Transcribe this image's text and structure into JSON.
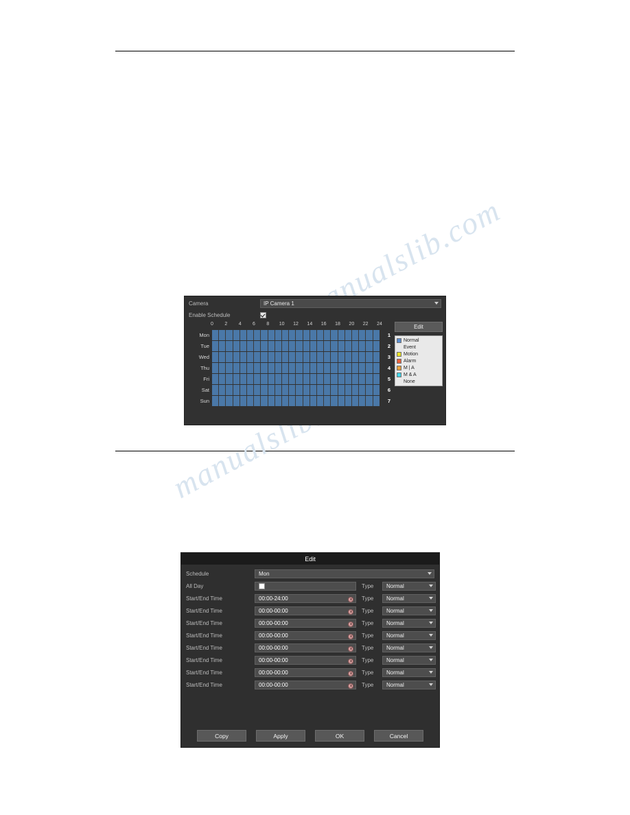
{
  "page": {
    "rules": [
      "top-rule",
      "bottom-rule"
    ],
    "watermark_text": "manualslib.com",
    "watermark_color": "#d8e4ef"
  },
  "figure_schedule": {
    "camera": {
      "label": "Camera",
      "value": "IP Camera 1"
    },
    "enable_schedule": {
      "label": "Enable Schedule",
      "checked": true
    },
    "hour_ticks": [
      "0",
      "2",
      "4",
      "6",
      "8",
      "10",
      "12",
      "14",
      "16",
      "18",
      "20",
      "22",
      "24"
    ],
    "days": [
      {
        "name": "Mon",
        "number": "1"
      },
      {
        "name": "Tue",
        "number": "2"
      },
      {
        "name": "Wed",
        "number": "3"
      },
      {
        "name": "Thu",
        "number": "4"
      },
      {
        "name": "Fri",
        "number": "5"
      },
      {
        "name": "Sat",
        "number": "6"
      },
      {
        "name": "Sun",
        "number": "7"
      }
    ],
    "edit_button": "Edit",
    "legend": [
      {
        "label": "Normal",
        "color": "#5a8ed0"
      },
      {
        "label": "Event",
        "color": "transparent"
      },
      {
        "label": "Motion",
        "color": "#e8e123"
      },
      {
        "label": "Alarm",
        "color": "#e8603c"
      },
      {
        "label": "M | A",
        "color": "#e8a13c"
      },
      {
        "label": "M & A",
        "color": "#3fd4e8"
      },
      {
        "label": "None",
        "color": "transparent"
      }
    ],
    "schedule_fill_color": "#4a78a8"
  },
  "figure_edit": {
    "title": "Edit",
    "schedule": {
      "label": "Schedule",
      "value": "Mon"
    },
    "all_day": {
      "label": "All Day",
      "checked": false,
      "type_label": "Type",
      "type_value": "Normal"
    },
    "rows": [
      {
        "label": "Start/End Time",
        "time": "00:00-24:00",
        "type_label": "Type",
        "type_value": "Normal"
      },
      {
        "label": "Start/End Time",
        "time": "00:00-00:00",
        "type_label": "Type",
        "type_value": "Normal"
      },
      {
        "label": "Start/End Time",
        "time": "00:00-00:00",
        "type_label": "Type",
        "type_value": "Normal"
      },
      {
        "label": "Start/End Time",
        "time": "00:00-00:00",
        "type_label": "Type",
        "type_value": "Normal"
      },
      {
        "label": "Start/End Time",
        "time": "00:00-00:00",
        "type_label": "Type",
        "type_value": "Normal"
      },
      {
        "label": "Start/End Time",
        "time": "00:00-00:00",
        "type_label": "Type",
        "type_value": "Normal"
      },
      {
        "label": "Start/End Time",
        "time": "00:00-00:00",
        "type_label": "Type",
        "type_value": "Normal"
      },
      {
        "label": "Start/End Time",
        "time": "00:00-00:00",
        "type_label": "Type",
        "type_value": "Normal"
      }
    ],
    "buttons": [
      {
        "label": "Copy"
      },
      {
        "label": "Apply"
      },
      {
        "label": "OK"
      },
      {
        "label": "Cancel"
      }
    ]
  }
}
